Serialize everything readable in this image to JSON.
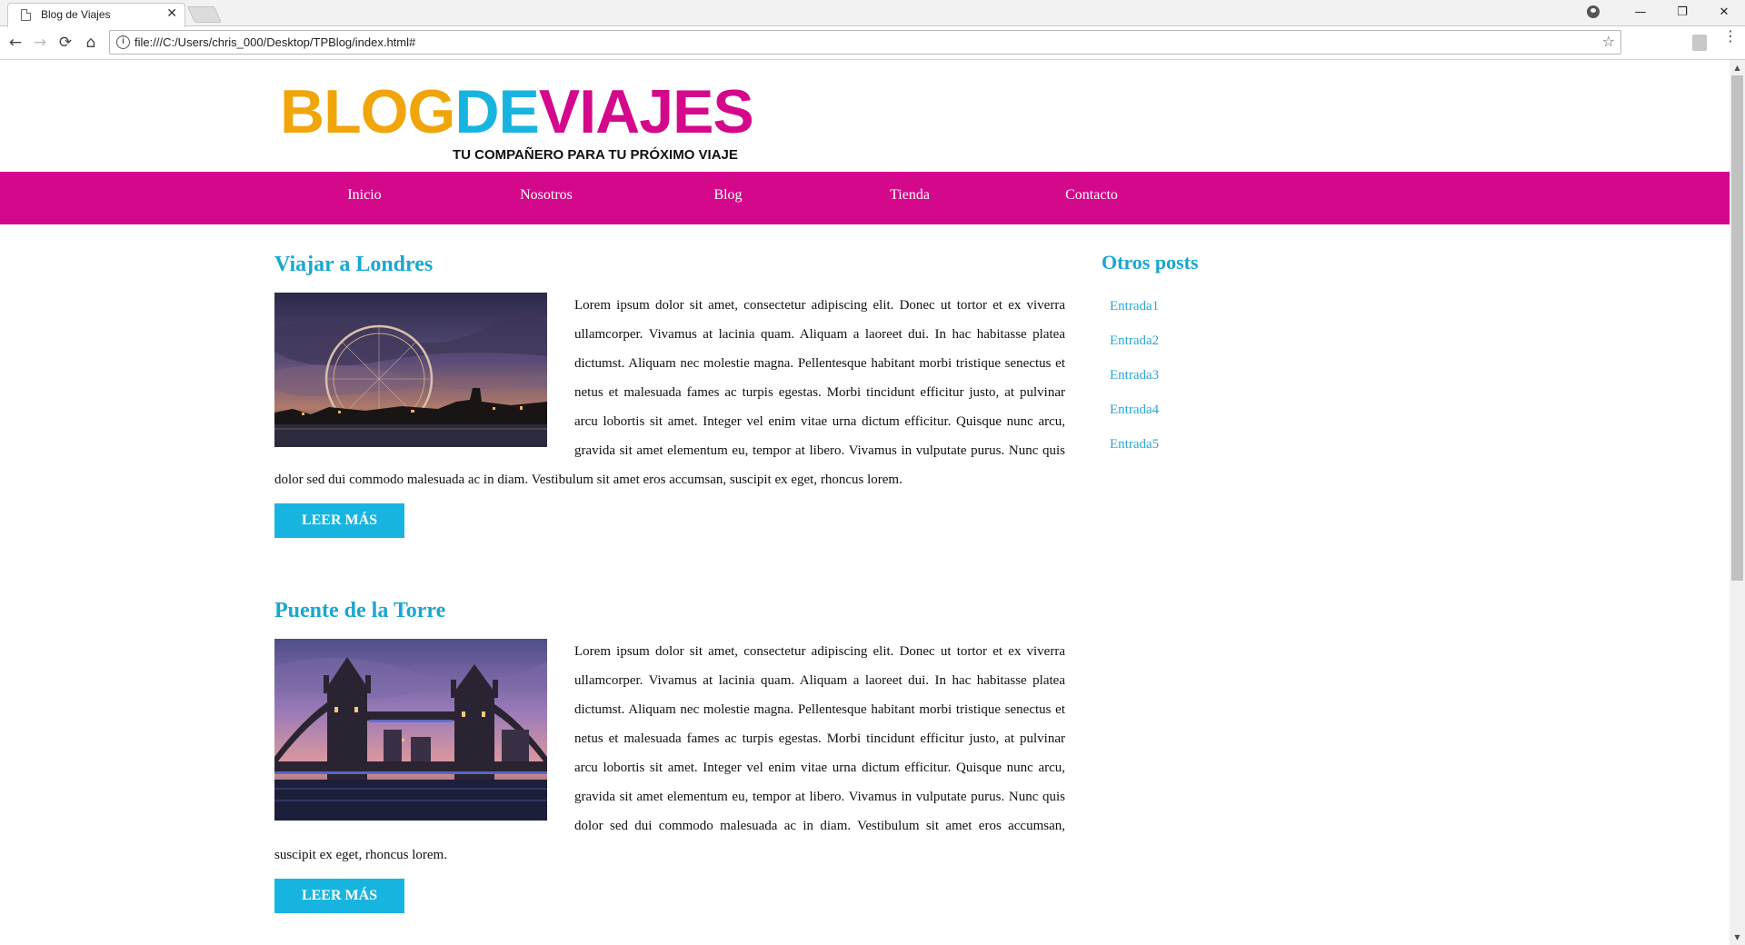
{
  "browser": {
    "tab_title": "Blog de Viajes",
    "tab_close": "✕",
    "url": "file:///C:/Users/chris_000/Desktop/TPBlog/index.html#",
    "info_glyph": "i",
    "back": "←",
    "forward": "→",
    "reload": "⟳",
    "home": "⌂",
    "star": "☆",
    "menu": "⋮",
    "minimize": "—",
    "restore": "❐",
    "close": "✕"
  },
  "header": {
    "logo_blog": "BLOG",
    "logo_de": "DE",
    "logo_viajes": "VIAJES",
    "tagline": "TU COMPAÑERO PARA TU PRÓXIMO VIAJE"
  },
  "nav": {
    "items": [
      {
        "label": "Inicio"
      },
      {
        "label": "Nosotros"
      },
      {
        "label": "Blog"
      },
      {
        "label": "Tienda"
      },
      {
        "label": "Contacto"
      }
    ]
  },
  "posts": [
    {
      "title": "Viajar a Londres",
      "body": "Lorem ipsum dolor sit amet, consectetur adipiscing elit. Donec ut tortor et ex viverra ullamcorper. Vivamus at lacinia quam. Aliquam a laoreet dui. In hac habitasse platea dictumst. Aliquam nec molestie magna. Pellentesque habitant morbi tristique senectus et netus et malesuada fames ac turpis egestas. Morbi tincidunt efficitur justo, at pulvinar arcu lobortis sit amet. Integer vel enim vitae urna dictum efficitur. Quisque nunc arcu, gravida sit amet elementum eu, tempor at libero. Vivamus in vulputate purus. Nunc quis dolor sed dui commodo malesuada ac in diam. Vestibulum sit amet eros accumsan, suscipit ex eget, rhoncus lorem.",
      "button": "LEER MÁS"
    },
    {
      "title": "Puente de la Torre",
      "body": "Lorem ipsum dolor sit amet, consectetur adipiscing elit. Donec ut tortor et ex viverra ullamcorper. Vivamus at lacinia quam. Aliquam a laoreet dui. In hac habitasse platea dictumst. Aliquam nec molestie magna. Pellentesque habitant morbi tristique senectus et netus et malesuada fames ac turpis egestas. Morbi tincidunt efficitur justo, at pulvinar arcu lobortis sit amet. Integer vel enim vitae urna dictum efficitur. Quisque nunc arcu, gravida sit amet elementum eu, tempor at libero. Vivamus in vulputate purus. Nunc quis dolor sed dui commodo malesuada ac in diam. Vestibulum sit amet eros accumsan, suscipit ex eget, rhoncus lorem.",
      "button": "LEER MÁS"
    }
  ],
  "sidebar": {
    "title": "Otros posts",
    "items": [
      {
        "label": "Entrada1"
      },
      {
        "label": "Entrada2"
      },
      {
        "label": "Entrada3"
      },
      {
        "label": "Entrada4"
      },
      {
        "label": "Entrada5"
      }
    ]
  },
  "colors": {
    "brand_pink": "#d4088b",
    "brand_blue": "#18b4e0",
    "logo_orange": "#f0a50a"
  }
}
